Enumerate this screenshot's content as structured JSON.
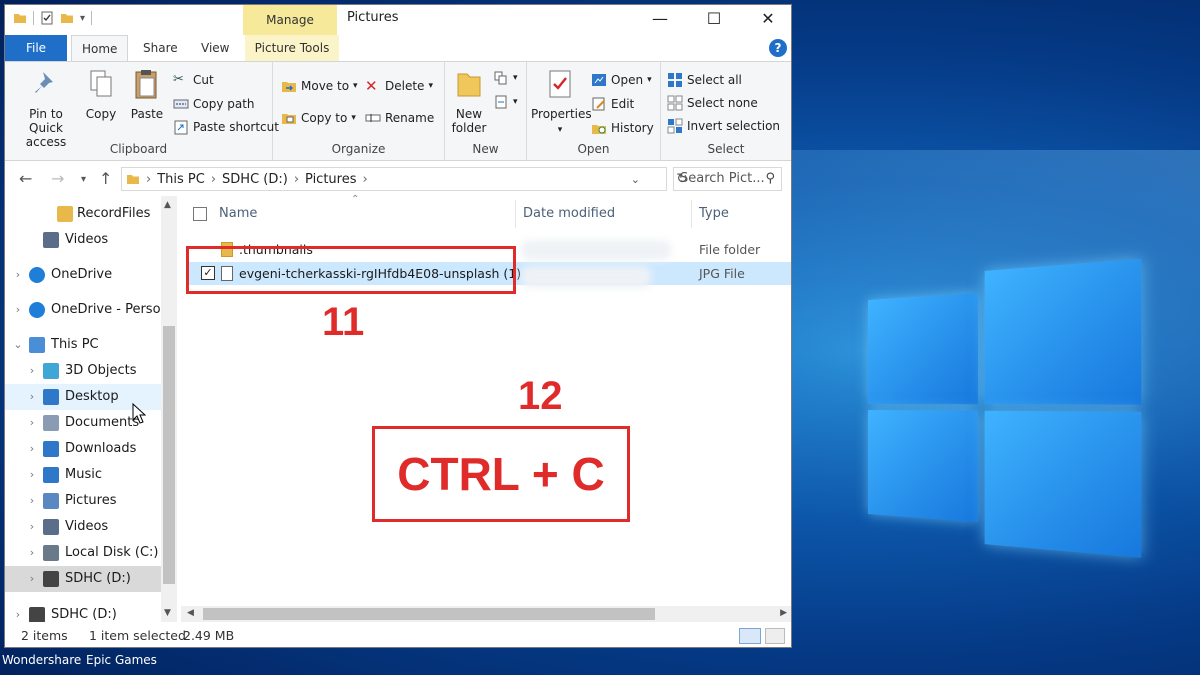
{
  "window": {
    "title": "Pictures",
    "manage_tab": "Manage",
    "minimize": "—",
    "maximize": "☐",
    "close": "✕"
  },
  "ribbon_tabs": {
    "file": "File",
    "home": "Home",
    "share": "Share",
    "view": "View",
    "picture_tools": "Picture Tools",
    "help": "?"
  },
  "ribbon": {
    "clipboard": {
      "label": "Clipboard",
      "pin": "Pin to Quick\naccess",
      "copy": "Copy",
      "paste": "Paste",
      "cut": "Cut",
      "copy_path": "Copy path",
      "paste_shortcut": "Paste shortcut"
    },
    "organize": {
      "label": "Organize",
      "move_to": "Move to",
      "copy_to": "Copy to",
      "delete": "Delete",
      "rename": "Rename"
    },
    "new": {
      "label": "New",
      "new_folder": "New\nfolder"
    },
    "open": {
      "label": "Open",
      "properties": "Properties",
      "open": "Open",
      "edit": "Edit",
      "history": "History"
    },
    "select": {
      "label": "Select",
      "select_all": "Select all",
      "select_none": "Select none",
      "invert_selection": "Invert selection"
    }
  },
  "address": {
    "crumbs": [
      "This PC",
      "SDHC (D:)",
      "Pictures"
    ],
    "search_placeholder": "Search Pict..."
  },
  "nav": [
    {
      "label": "RecordFiles",
      "icon": "folder-icon",
      "indent": 1,
      "arrow": ""
    },
    {
      "label": "Videos",
      "icon": "videos-icon",
      "indent": 1,
      "arrow": ""
    },
    {
      "label": "OneDrive",
      "icon": "cloud-icon",
      "indent": 0,
      "arrow": ">"
    },
    {
      "label": "OneDrive - Person",
      "icon": "cloud-icon",
      "indent": 0,
      "arrow": ">"
    },
    {
      "label": "This PC",
      "icon": "pc-icon",
      "indent": 0,
      "arrow": "v"
    },
    {
      "label": "3D Objects",
      "icon": "3d-objects-icon",
      "indent": 1,
      "arrow": ">"
    },
    {
      "label": "Desktop",
      "icon": "desktop-icon",
      "indent": 1,
      "arrow": ">"
    },
    {
      "label": "Documents",
      "icon": "documents-icon",
      "indent": 1,
      "arrow": ">"
    },
    {
      "label": "Downloads",
      "icon": "downloads-icon",
      "indent": 1,
      "arrow": ">"
    },
    {
      "label": "Music",
      "icon": "music-icon",
      "indent": 1,
      "arrow": ">"
    },
    {
      "label": "Pictures",
      "icon": "pictures-icon",
      "indent": 1,
      "arrow": ">"
    },
    {
      "label": "Videos",
      "icon": "videos-icon",
      "indent": 1,
      "arrow": ">"
    },
    {
      "label": "Local Disk (C:)",
      "icon": "drive-icon",
      "indent": 1,
      "arrow": ">"
    },
    {
      "label": "SDHC (D:)",
      "icon": "sd-card-icon",
      "indent": 1,
      "arrow": ">"
    },
    {
      "label": "SDHC (D:)",
      "icon": "sd-card-icon",
      "indent": 0,
      "arrow": ">"
    }
  ],
  "columns": {
    "name": "Name",
    "date_modified": "Date modified",
    "type": "Type"
  },
  "files": [
    {
      "name": ".thumbnails",
      "type": "File folder",
      "icon": "folder-icon",
      "selected": false
    },
    {
      "name": "evgeni-tcherkasski-rgIHfdb4E08-unsplash (1)",
      "type": "JPG File",
      "icon": "image-file-icon",
      "selected": true
    }
  ],
  "status": {
    "items": "2 items",
    "selected": "1 item selected",
    "size": "2.49 MB"
  },
  "taskbar": {
    "app1": "Wondershare",
    "app2": "Epic Games"
  },
  "annotations": {
    "step11": "11",
    "step12": "12",
    "shortcut": "CTRL + C"
  },
  "colors": {
    "accent": "#1f6fc8",
    "annotation": "#e02b2b",
    "manage": "#f6e99a"
  }
}
